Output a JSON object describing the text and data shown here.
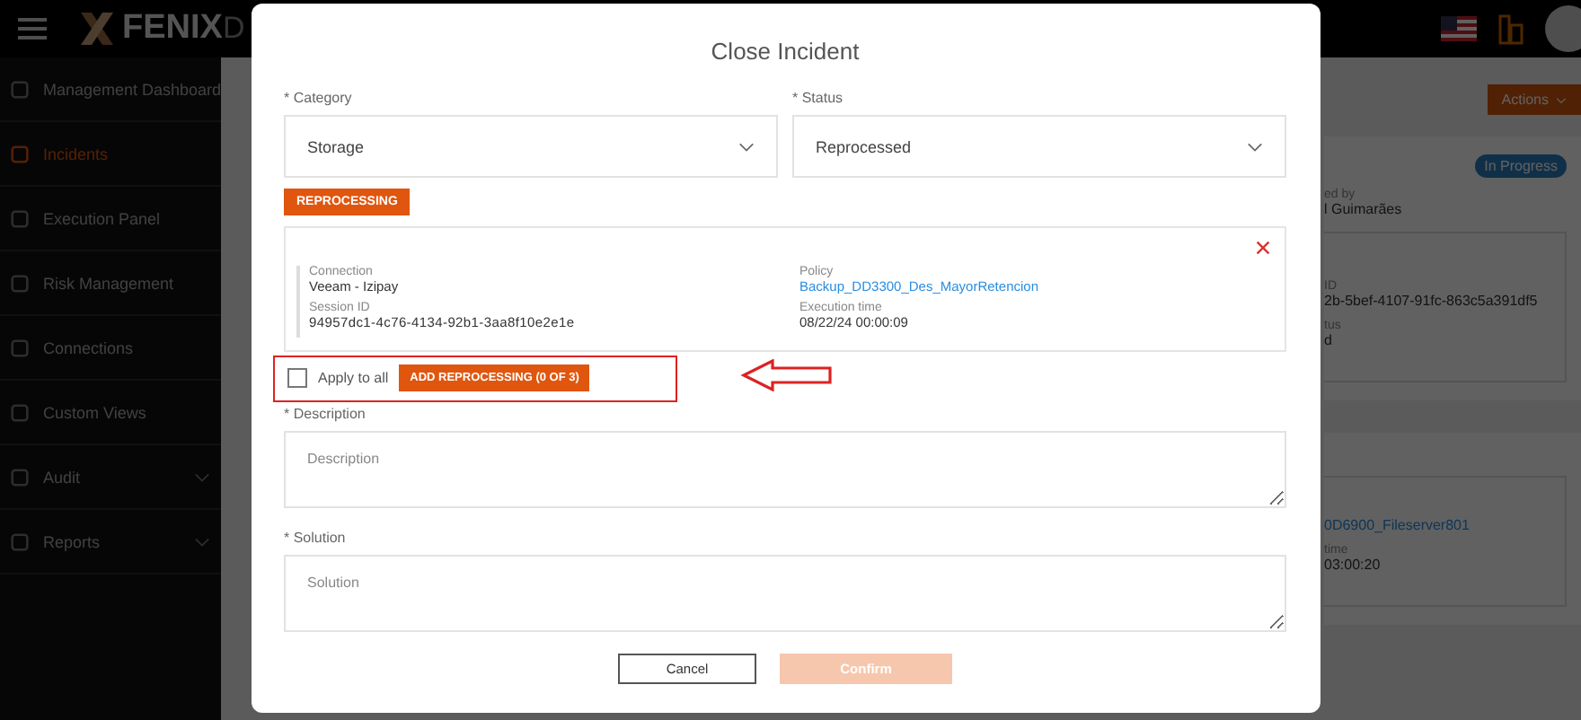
{
  "header": {
    "brand": "FENIX",
    "brand_cut": "D"
  },
  "sidebar": {
    "items": [
      {
        "label": "Management Dashboard",
        "selected": false,
        "expandable": false
      },
      {
        "label": "Incidents",
        "selected": true,
        "expandable": false
      },
      {
        "label": "Execution Panel",
        "selected": false,
        "expandable": false
      },
      {
        "label": "Risk Management",
        "selected": false,
        "expandable": false
      },
      {
        "label": "Connections",
        "selected": false,
        "expandable": false
      },
      {
        "label": "Custom Views",
        "selected": false,
        "expandable": false
      },
      {
        "label": "Audit",
        "selected": false,
        "expandable": true
      },
      {
        "label": "Reports",
        "selected": false,
        "expandable": true
      }
    ]
  },
  "background": {
    "actions_button": "Actions",
    "status_badge": "In Progress",
    "created_by_label": "ed by",
    "created_by_value": "l Guimarães",
    "card_1": [
      {
        "label": "ID",
        "value": "2b-5bef-4107-91fc-863c5a391df5"
      },
      {
        "label": "tus",
        "value": "d"
      }
    ],
    "card_2": [
      {
        "value": "0D6900_Fileserver801",
        "link": true
      },
      {
        "label": "time",
        "value": "03:00:20",
        "link": false
      }
    ]
  },
  "modal": {
    "title": "Close Incident",
    "category": {
      "label": "* Category",
      "value": "Storage"
    },
    "status": {
      "label": "* Status",
      "value": "Reprocessed"
    },
    "tag": "REPROCESSING",
    "reprocessing_card": {
      "left": [
        {
          "label": "Connection",
          "value": "Veeam - Izipay",
          "link": false
        },
        {
          "label": "Session ID",
          "value": "94957dc1-4c76-4134-92b1-3aa8f10e2e1e",
          "link": false
        }
      ],
      "right": [
        {
          "label": "Policy",
          "value": "Backup_DD3300_Des_MayorRetencion",
          "link": true
        },
        {
          "label": "Execution time",
          "value": "08/22/24 00:00:09",
          "link": false
        }
      ]
    },
    "apply_to_all": {
      "label": "Apply to all",
      "checked": false
    },
    "add_button": "ADD REPROCESSING (0 OF 3)",
    "description": {
      "label": "* Description",
      "placeholder": "Description"
    },
    "solution": {
      "label": "* Solution",
      "placeholder": "Solution"
    },
    "cancel_button": "Cancel",
    "confirm_button": {
      "label": "Confirm",
      "disabled": true
    }
  }
}
